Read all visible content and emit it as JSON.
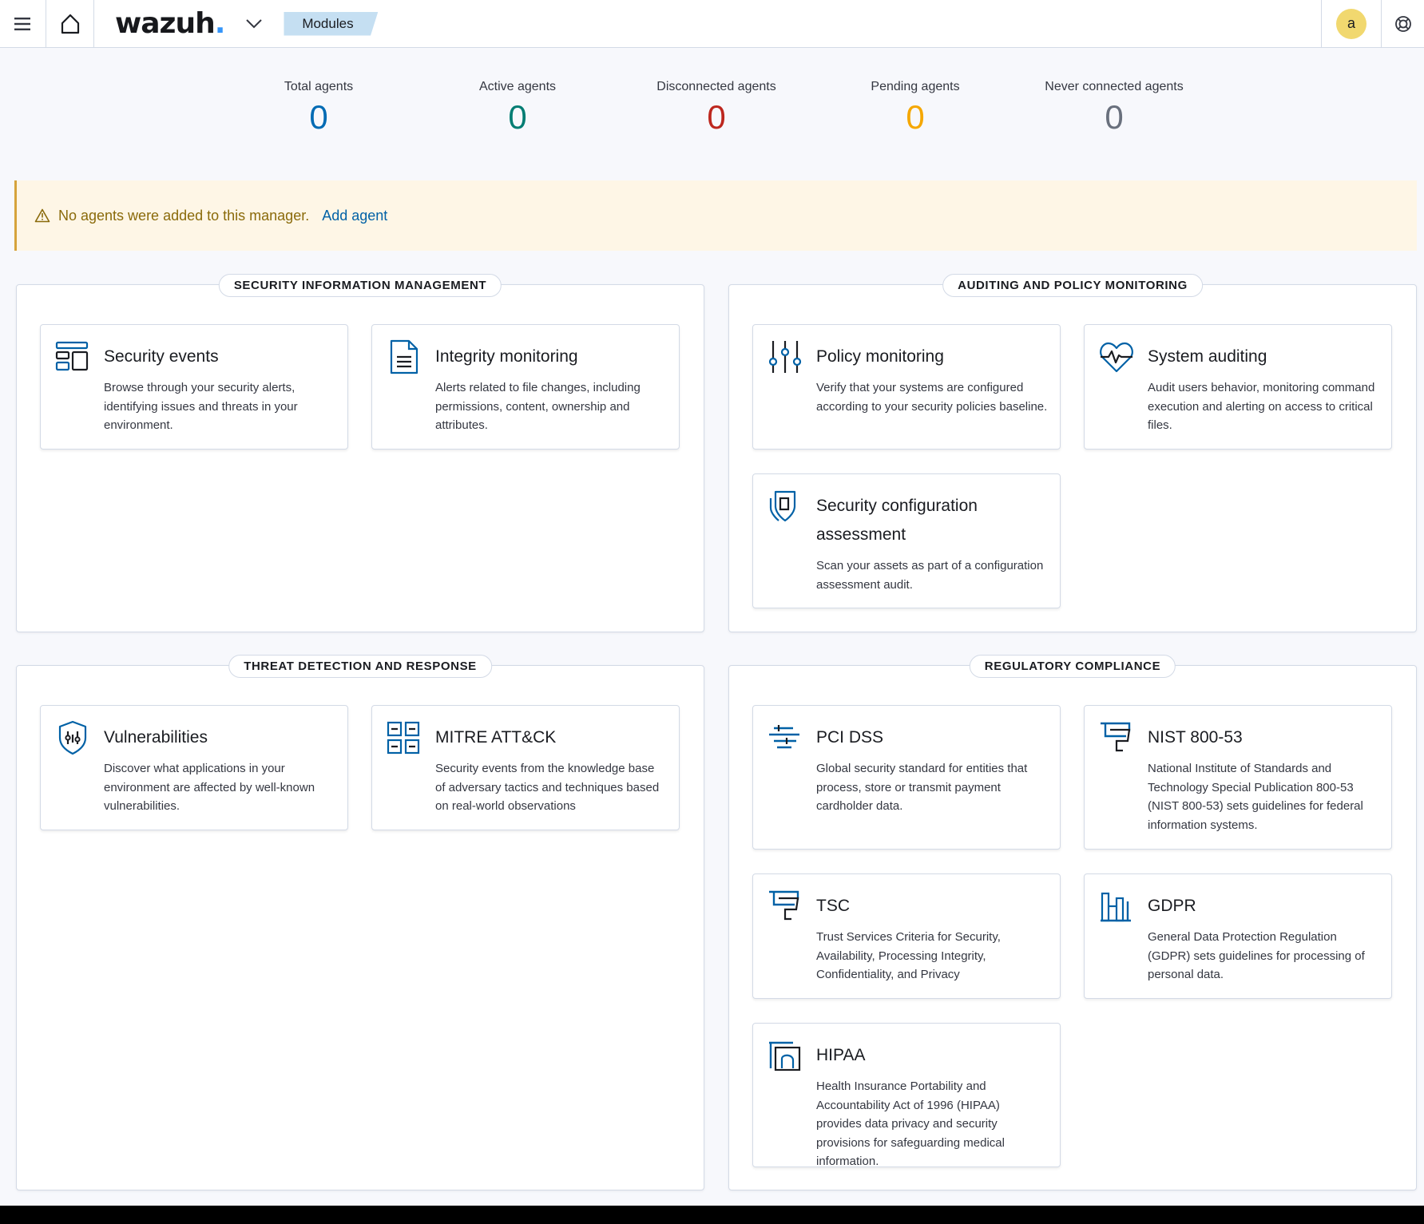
{
  "header": {
    "logo_text": "wazuh",
    "logo_dot": ".",
    "breadcrumb": "Modules",
    "avatar_letter": "a",
    "icons": [
      "menu-icon",
      "home-icon",
      "chevron-down-icon",
      "help-icon"
    ]
  },
  "stats": [
    {
      "label": "Total agents",
      "value": "0",
      "color": "#006bb4"
    },
    {
      "label": "Active agents",
      "value": "0",
      "color": "#017d73"
    },
    {
      "label": "Disconnected agents",
      "value": "0",
      "color": "#bd271e"
    },
    {
      "label": "Pending agents",
      "value": "0",
      "color": "#f5a700"
    },
    {
      "label": "Never connected agents",
      "value": "0",
      "color": "#69707d"
    }
  ],
  "callout": {
    "message": "No agents were added to this manager.",
    "link": "Add agent",
    "icon": "warning-icon"
  },
  "panels": {
    "sim": {
      "title": "SECURITY INFORMATION MANAGEMENT",
      "cards": [
        {
          "title": "Security events",
          "desc": "Browse through your security alerts, identifying issues and threats in your environment.",
          "icon": "dashboard-icon"
        },
        {
          "title": "Integrity monitoring",
          "desc": "Alerts related to file changes, including permissions, content, ownership and attributes.",
          "icon": "document-icon"
        }
      ]
    },
    "apm": {
      "title": "AUDITING AND POLICY MONITORING",
      "cards": [
        {
          "title": "Policy monitoring",
          "desc": "Verify that your systems are configured according to your security policies baseline.",
          "icon": "sliders-icon"
        },
        {
          "title": "System auditing",
          "desc": "Audit users behavior, monitoring command execution and alerting on access to critical files.",
          "icon": "heart-monitor-icon"
        },
        {
          "title": "Security configuration assessment",
          "desc": "Scan your assets as part of a configuration assessment audit.",
          "icon": "shield-check-icon"
        }
      ]
    },
    "tdr": {
      "title": "THREAT DETECTION AND RESPONSE",
      "cards": [
        {
          "title": "Vulnerabilities",
          "desc": "Discover what applications in your environment are affected by well-known vulnerabilities.",
          "icon": "shield-bug-icon"
        },
        {
          "title": "MITRE ATT&CK",
          "desc": "Security events from the knowledge base of adversary tactics and techniques based on real-world observations",
          "icon": "grid-icon"
        }
      ]
    },
    "rc": {
      "title": "REGULATORY COMPLIANCE",
      "cards": [
        {
          "title": "PCI DSS",
          "desc": "Global security standard for entities that process, store or transmit payment cardholder data.",
          "icon": "lines-icon"
        },
        {
          "title": "NIST 800-53",
          "desc": "National Institute of Standards and Technology Special Publication 800-53 (NIST 800-53) sets guidelines for federal information systems.",
          "icon": "flag-icon"
        },
        {
          "title": "TSC",
          "desc": "Trust Services Criteria for Security, Availability, Processing Integrity, Confidentiality, and Privacy",
          "icon": "flag-icon"
        },
        {
          "title": "GDPR",
          "desc": "General Data Protection Regulation (GDPR) sets guidelines for processing of personal data.",
          "icon": "bars-icon"
        },
        {
          "title": "HIPAA",
          "desc": "Health Insurance Portability and Accountability Act of 1996 (HIPAA) provides data privacy and security provisions for safeguarding medical information.",
          "icon": "frame-icon"
        }
      ]
    }
  }
}
